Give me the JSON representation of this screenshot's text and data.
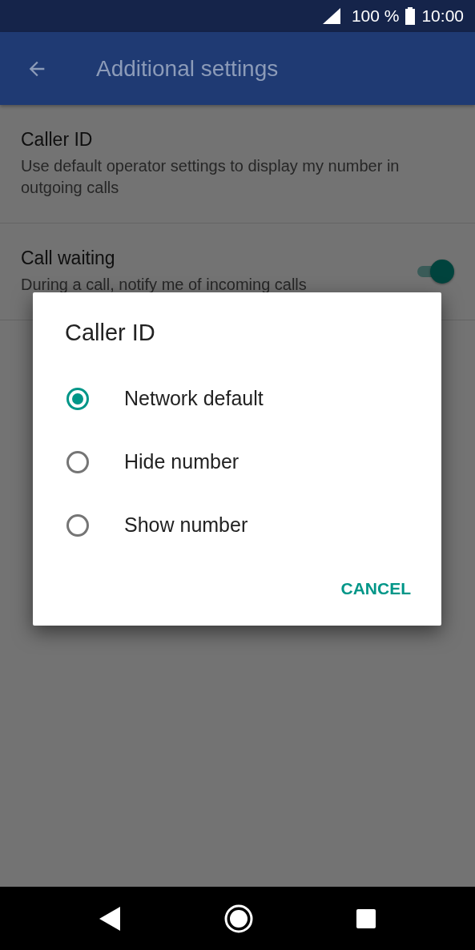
{
  "status_bar": {
    "battery": "100 %",
    "time": "10:00"
  },
  "app_bar": {
    "title": "Additional settings"
  },
  "settings": [
    {
      "kind": "text",
      "title": "Caller ID",
      "summary": "Use default operator settings to display my number in outgoing calls"
    },
    {
      "kind": "switch",
      "title": "Call waiting",
      "summary": "During a call, notify me of incoming calls",
      "on": true
    }
  ],
  "dialog": {
    "title": "Caller ID",
    "options": [
      {
        "label": "Network default",
        "selected": true
      },
      {
        "label": "Hide number",
        "selected": false
      },
      {
        "label": "Show number",
        "selected": false
      }
    ],
    "buttons": [
      "CANCEL"
    ]
  }
}
